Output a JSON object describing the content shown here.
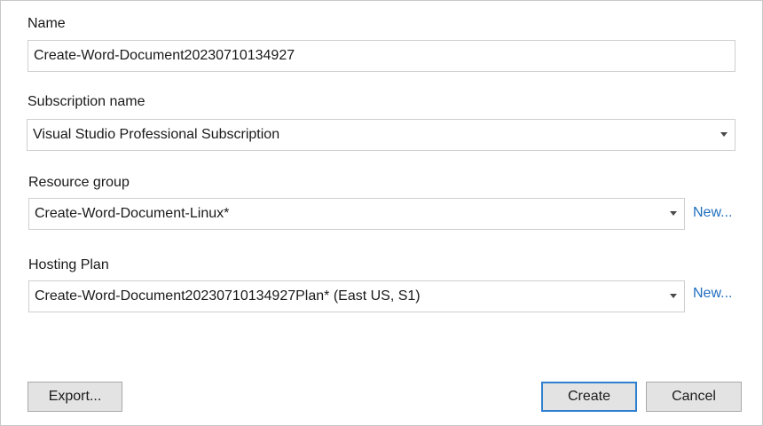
{
  "form": {
    "name": {
      "label": "Name",
      "value": "Create-Word-Document20230710134927"
    },
    "subscription": {
      "label": "Subscription name",
      "value": "Visual Studio Professional Subscription"
    },
    "resource_group": {
      "label": "Resource group",
      "value": "Create-Word-Document-Linux*",
      "new_link": "New..."
    },
    "hosting_plan": {
      "label": "Hosting Plan",
      "value": "Create-Word-Document20230710134927Plan* (East US, S1)",
      "new_link": "New..."
    }
  },
  "buttons": {
    "export": "Export...",
    "create": "Create",
    "cancel": "Cancel"
  },
  "colors": {
    "link": "#1f6fbf",
    "primary_border": "#2f7fd0",
    "button_bg": "#e3e3e3",
    "field_border": "#cfcfcf"
  },
  "icons": {
    "dropdown": "chevron-down-icon"
  }
}
